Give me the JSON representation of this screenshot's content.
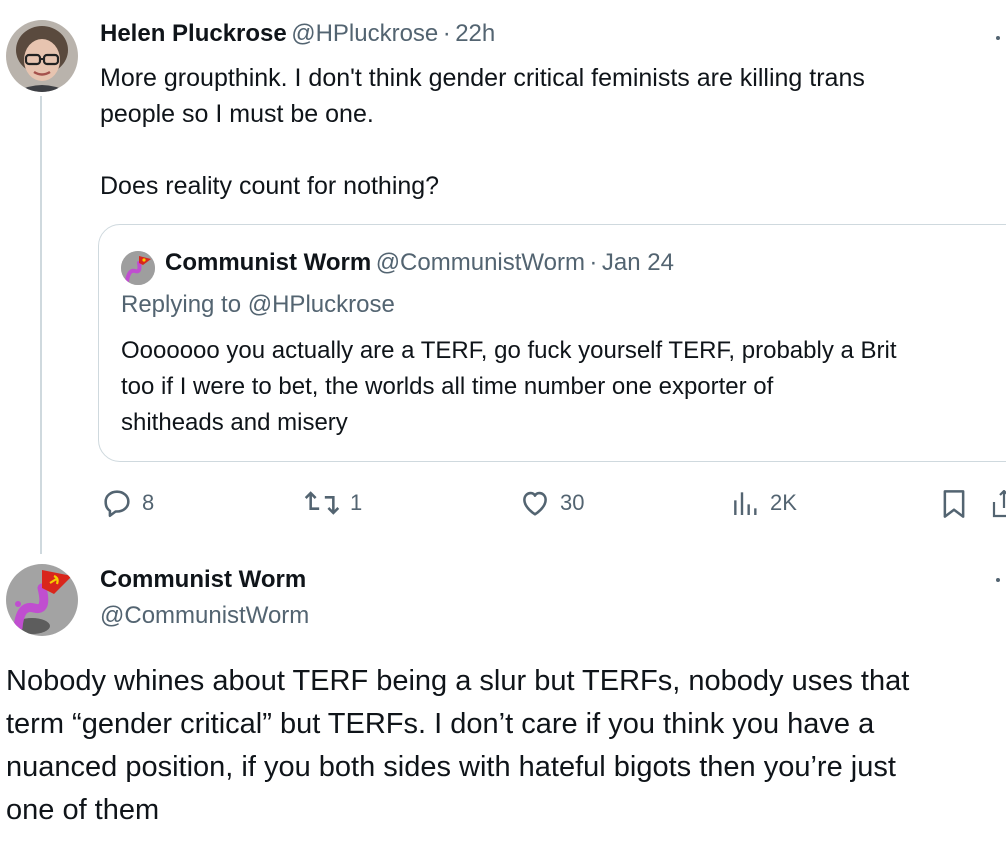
{
  "tweet1": {
    "author_name": "Helen Pluckrose",
    "author_handle": "@HPluckrose",
    "separator": "·",
    "time": "22h",
    "text_line1": "More groupthink. I don't think gender critical feminists are killing trans",
    "text_line2": "people so I must be one.",
    "text_line3": "Does reality count for nothing?",
    "actions": {
      "replies": "8",
      "reposts": "1",
      "likes": "30",
      "views": "2K"
    }
  },
  "quoted": {
    "author_name": "Communist Worm",
    "author_handle": "@CommunistWorm",
    "separator": "·",
    "date": "Jan 24",
    "replying_to": "Replying to @HPluckrose",
    "text_line1": "Ooooooo you actually are a TERF, go fuck yourself TERF, probably a Brit",
    "text_line2": "too if I were to bet, the worlds all time number one exporter of",
    "text_line3": "shitheads and misery"
  },
  "tweet2": {
    "author_name": "Communist Worm",
    "author_handle": "@CommunistWorm",
    "text_line1": "Nobody whines about TERF being a slur but TERFs, nobody uses that",
    "text_line2": "term “gender critical” but TERFs. I don’t care if you think you have a",
    "text_line3": "nuanced position, if you both sides with hateful bigots then you’re just",
    "text_line4": "one of them"
  },
  "icons": {
    "reply": "reply-icon",
    "repost": "repost-icon",
    "like": "heart-icon",
    "views": "views-icon",
    "bookmark": "bookmark-icon",
    "share": "share-icon",
    "more": "more-icon"
  },
  "colors": {
    "text": "#0f1419",
    "secondary": "#536471",
    "border": "#cfd9de",
    "flag_red": "#d9261c",
    "worm_purple": "#c04ed0"
  }
}
